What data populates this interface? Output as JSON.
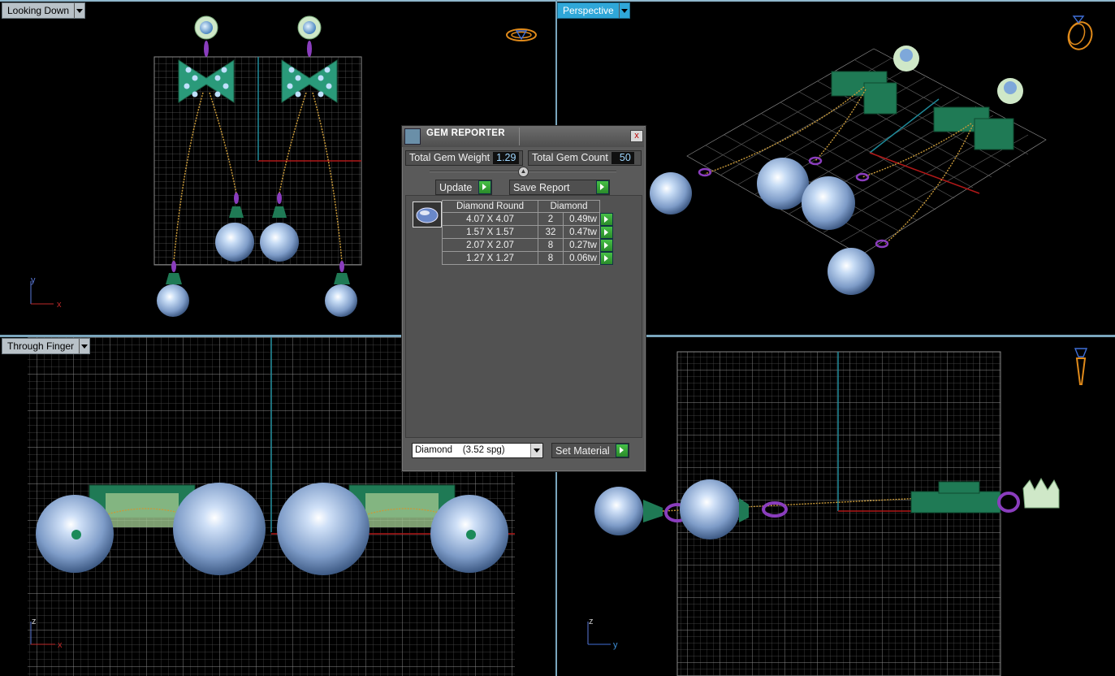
{
  "viewports": {
    "top_left": {
      "label": "Looking Down",
      "axes": {
        "a": "y",
        "b": "x"
      }
    },
    "top_right": {
      "label": "Perspective"
    },
    "bottom_left": {
      "label": "Through Finger",
      "axes": {
        "a": "z",
        "b": "x"
      }
    },
    "bottom_right": {
      "axes": {
        "a": "z",
        "b": "y"
      }
    }
  },
  "gem_reporter": {
    "title": "GEM REPORTER",
    "close_glyph": "x",
    "total_weight_label": "Total Gem Weight",
    "total_weight_value": "1.29",
    "total_count_label": "Total Gem Count",
    "total_count_value": "50",
    "update_label": "Update",
    "save_report_label": "Save Report",
    "table": {
      "header_shape": "Diamond Round",
      "header_material": "Diamond",
      "rows": [
        {
          "size": "4.07 X 4.07",
          "count": "2",
          "weight": "0.49tw"
        },
        {
          "size": "1.57 X 1.57",
          "count": "32",
          "weight": "0.47tw"
        },
        {
          "size": "2.07 X 2.07",
          "count": "8",
          "weight": "0.27tw"
        },
        {
          "size": "1.27 X 1.27",
          "count": "8",
          "weight": "0.06tw"
        }
      ]
    },
    "material_select": "Diamond    (3.52 spg)",
    "set_material_label": "Set Material"
  },
  "colors": {
    "grid": "#6b6b6b",
    "accent_blue": "#2fa7d8",
    "axis_red": "#b01818",
    "axis_cyan": "#1f8a9a",
    "pearl": "#a8c4e8",
    "metal_green": "#1f7a55",
    "link_purple": "#8a3dbd",
    "chain_gold": "#c99a3a"
  }
}
